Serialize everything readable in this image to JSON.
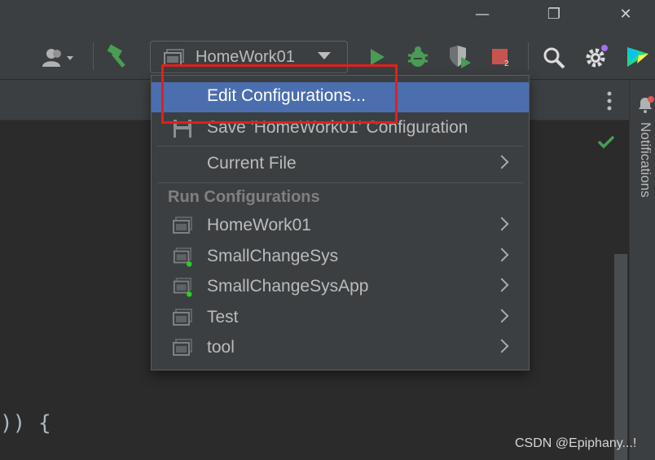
{
  "window": {
    "minimize_glyph": "—",
    "restore_glyph": "❐",
    "close_glyph": "✕"
  },
  "toolbar": {
    "icons": [
      "user-icon",
      "build-hammer-icon",
      "run-icon",
      "debug-icon",
      "coverage-icon",
      "stop-icon",
      "search-icon",
      "settings-icon",
      "jetbrains-toolbox-icon"
    ],
    "stop_badge": "2",
    "run_config_selected": "HomeWork01"
  },
  "menu": {
    "items_top": [
      {
        "label": "Edit Configurations...",
        "selected": true
      },
      {
        "label": "Save 'HomeWork01' Configuration",
        "icon": "save-icon"
      },
      {
        "label": "Current File",
        "submenu": true
      }
    ],
    "section_header": "Run Configurations",
    "configurations": [
      {
        "label": "HomeWork01",
        "running": false
      },
      {
        "label": "SmallChangeSys",
        "running": true
      },
      {
        "label": "SmallChangeSysApp",
        "running": true
      },
      {
        "label": "Test",
        "running": false
      },
      {
        "label": "tool",
        "running": false
      }
    ]
  },
  "sidebar": {
    "notifications_label": "Notifications"
  },
  "editor": {
    "code_fragment": ")) {"
  },
  "watermark": "CSDN @Epiphany...!",
  "colors": {
    "accent_selected": "#4b6eaf",
    "highlight_box": "#e0201c",
    "run_green": "#499c54",
    "stop_red": "#c75450"
  }
}
